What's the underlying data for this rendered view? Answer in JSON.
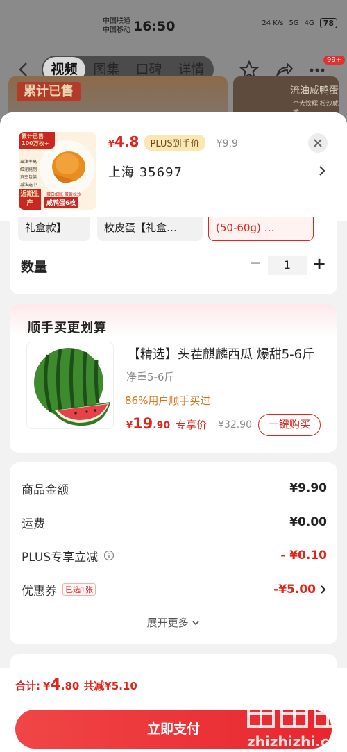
{
  "status_bar": {
    "carrier1": "中国联通",
    "carrier2": "中国移动",
    "time": "16:50",
    "speed": "24 K/s",
    "net1": "5G",
    "net2": "4G",
    "battery": "78"
  },
  "nav": {
    "tabs": [
      "视频",
      "图集",
      "口碑",
      "详情"
    ],
    "active_tab": "视频",
    "badge": "99+"
  },
  "banner": {
    "left_tag": "累计已售",
    "right_title": "流油咸鸭蛋",
    "right_sub": "个大饮糯 松沙咸香"
  },
  "product": {
    "thumb_tag": "累计已售100万枚+",
    "thumb_points": [
      "出油率高",
      "红泥腌制",
      "真空包装",
      "减法选中"
    ],
    "thumb_corner": "近期生产",
    "thumb_sub": "蛋白细腻 蛋黄松沙",
    "thumb_name": "咸鸭蛋6枚",
    "price_symbol": "¥",
    "price": "4.8",
    "plus_label": "PLUS到手价",
    "original_price": "¥9.9",
    "address": "上海 35697"
  },
  "variants": [
    {
      "label": "礼盒款】",
      "selected": false
    },
    {
      "label": "枚皮蛋【礼盒…",
      "selected": false
    },
    {
      "label": "(50-60g) …",
      "selected": true
    }
  ],
  "quantity": {
    "label": "数量",
    "minus": "−",
    "value": "1",
    "plus": "+"
  },
  "upsell": {
    "title": "顺手买更划算",
    "name": "【精选】头茬麒麟西瓜 爆甜5-6斤",
    "weight": "净重5-6斤",
    "rate": "86%用户顺手买过",
    "price_symbol": "¥",
    "price_int": "19",
    "price_dec": ".90",
    "price_label": "专享价",
    "original_price": "¥32.90",
    "button": "一键购买"
  },
  "summary": {
    "rows": [
      {
        "label": "商品金额",
        "value": "¥9.90"
      },
      {
        "label": "运费",
        "value": "¥0.00"
      },
      {
        "label": "PLUS专享立减",
        "value": "- ¥0.10"
      },
      {
        "label": "优惠券",
        "tag": "已选1张",
        "value": "-¥5.00"
      }
    ],
    "expand": "展开更多"
  },
  "footer": {
    "total_label": "合计:",
    "total_symbol": "¥",
    "total_int": "4",
    "total_dec": ".80",
    "saving": "共减¥5.10",
    "pay_button": "立即支付"
  },
  "watermark": "zhizhizhi.com",
  "colors": {
    "accent": "#e1251b",
    "plus_tag_bg": "#fbe7b3",
    "upsell_rate": "#d9731a"
  }
}
